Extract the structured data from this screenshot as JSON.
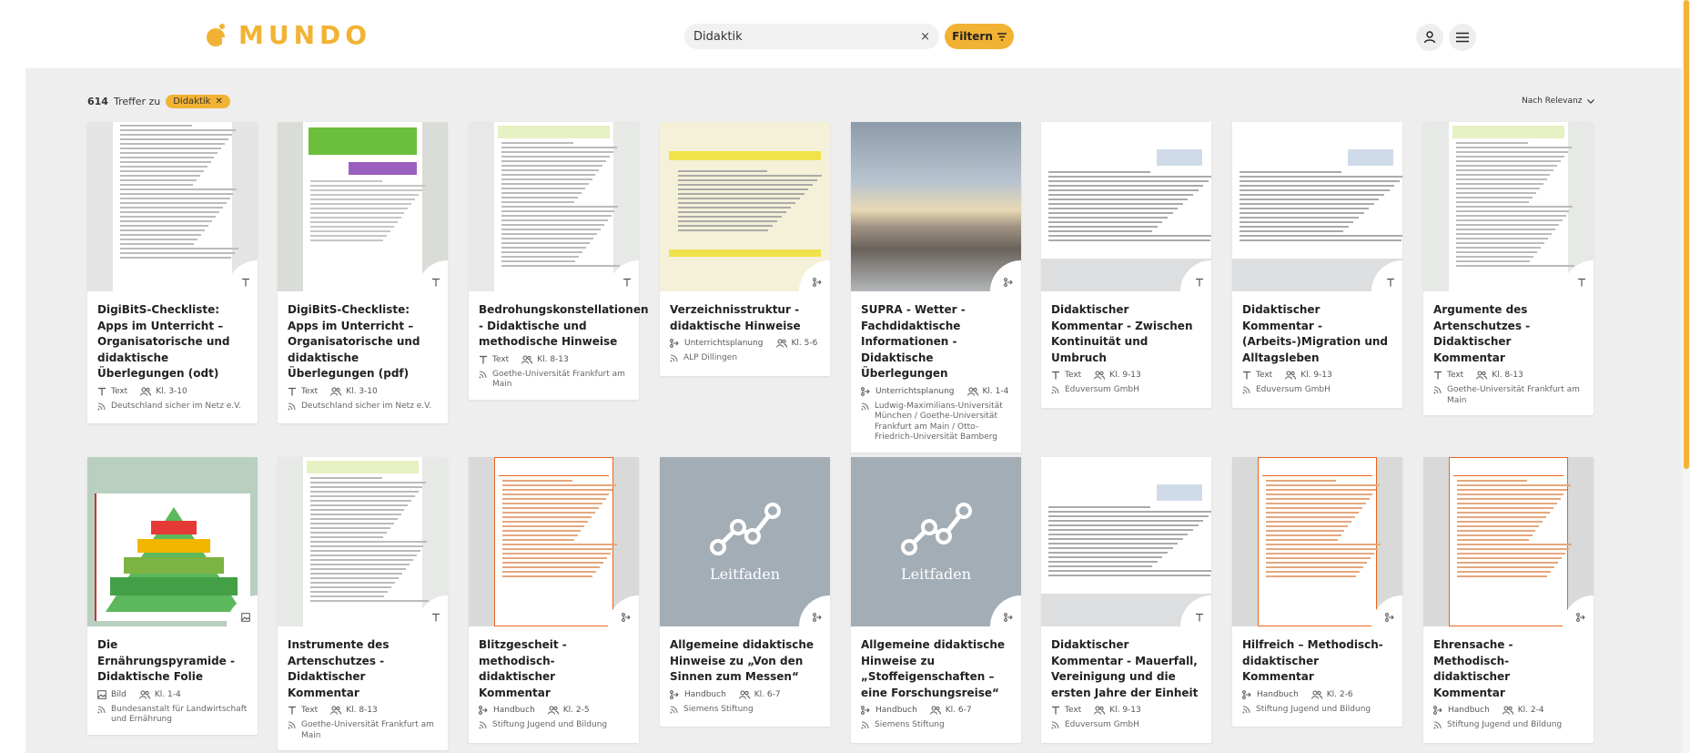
{
  "header": {
    "logo_text": "MUNDO",
    "search_value": "Didaktik",
    "search_clear": "×",
    "filter_label": "Filtern",
    "brand_color": "#f2b233"
  },
  "results": {
    "count": "614",
    "label": "Treffer zu",
    "chip": "Didaktik",
    "sort": "Nach Relevanz"
  },
  "cards": [
    {
      "title": "DigiBitS-Checkliste: Apps im Unterricht – Organisatorische und didaktische Überlegungen (odt)",
      "type": "Text",
      "type_icon": "text-icon",
      "level": "Kl. 3-10",
      "source": "Deutschland sicher im Netz e.V."
    },
    {
      "title": "DigiBitS-Checkliste: Apps im Unterricht – Organisatorische und didaktische Überlegungen (pdf)",
      "type": "Text",
      "type_icon": "text-icon",
      "level": "Kl. 3-10",
      "source": "Deutschland sicher im Netz e.V."
    },
    {
      "title": "Bedrohungskonstellationen - Didaktische und methodische Hinweise",
      "type": "Text",
      "type_icon": "text-icon",
      "level": "Kl. 8-13",
      "source": "Goethe-Universität Frankfurt am Main"
    },
    {
      "title": "Verzeichnisstruktur - didaktische Hinweise",
      "type": "Unterrichtsplanung",
      "type_icon": "planning-icon",
      "level": "Kl. 5-6",
      "source": "ALP Dillingen"
    },
    {
      "title": "SUPRA - Wetter - Fachdidaktische Informationen - Didaktische Überlegungen",
      "type": "Unterrichtsplanung",
      "type_icon": "planning-icon",
      "level": "Kl. 1-4",
      "source": "Ludwig-Maximilians-Universität München / Goethe-Universität Frankfurt am Main / Otto-Friedrich-Universität Bamberg"
    },
    {
      "title": "Didaktischer Kommentar - Zwischen Kontinuität und Umbruch",
      "type": "Text",
      "type_icon": "text-icon",
      "level": "Kl. 9-13",
      "source": "Eduversum GmbH"
    },
    {
      "title": "Didaktischer Kommentar - (Arbeits-)Migration und Alltagsleben",
      "type": "Text",
      "type_icon": "text-icon",
      "level": "Kl. 9-13",
      "source": "Eduversum GmbH"
    },
    {
      "title": "Argumente des Artenschutzes - Didaktischer Kommentar",
      "type": "Text",
      "type_icon": "text-icon",
      "level": "Kl. 8-13",
      "source": "Goethe-Universität Frankfurt am Main"
    },
    {
      "title": "Die Ernährungspyramide - Didaktische Folie",
      "type": "Bild",
      "type_icon": "image-icon",
      "level": "Kl. 1-4",
      "source": "Bundesanstalt für Landwirtschaft und Ernährung"
    },
    {
      "title": "Instrumente des Artenschutzes - Didaktischer Kommentar",
      "type": "Text",
      "type_icon": "text-icon",
      "level": "Kl. 8-13",
      "source": "Goethe-Universität Frankfurt am Main"
    },
    {
      "title": "Blitzgescheit - methodisch-didaktischer Kommentar",
      "type": "Handbuch",
      "type_icon": "handbook-icon",
      "level": "Kl. 2-5",
      "source": "Stiftung Jugend und Bildung"
    },
    {
      "title": "Allgemeine didaktische Hinweise zu „Von den Sinnen zum Messen“",
      "type": "Handbuch",
      "type_icon": "handbook-icon",
      "level": "Kl. 6-7",
      "source": "Siemens Stiftung"
    },
    {
      "title": "Allgemeine didaktische Hinweise zu „Stoffeigenschaften – eine Forschungsreise“",
      "type": "Handbuch",
      "type_icon": "handbook-icon",
      "level": "Kl. 6-7",
      "source": "Siemens Stiftung"
    },
    {
      "title": "Didaktischer Kommentar - Mauerfall, Vereinigung und die ersten Jahre der Einheit",
      "type": "Text",
      "type_icon": "text-icon",
      "level": "Kl. 9-13",
      "source": "Eduversum GmbH"
    },
    {
      "title": "Hilfreich – Methodisch-didaktischer Kommentar",
      "type": "Handbuch",
      "type_icon": "handbook-icon",
      "level": "Kl. 2-6",
      "source": "Stiftung Jugend und Bildung"
    },
    {
      "title": "Ehrensache - Methodisch-didaktischer Kommentar",
      "type": "Handbuch",
      "type_icon": "handbook-icon",
      "level": "Kl. 2-4",
      "source": "Stiftung Jugend und Bildung"
    }
  ],
  "thumbnails": {
    "leitfaden_label": "Leitfaden"
  }
}
